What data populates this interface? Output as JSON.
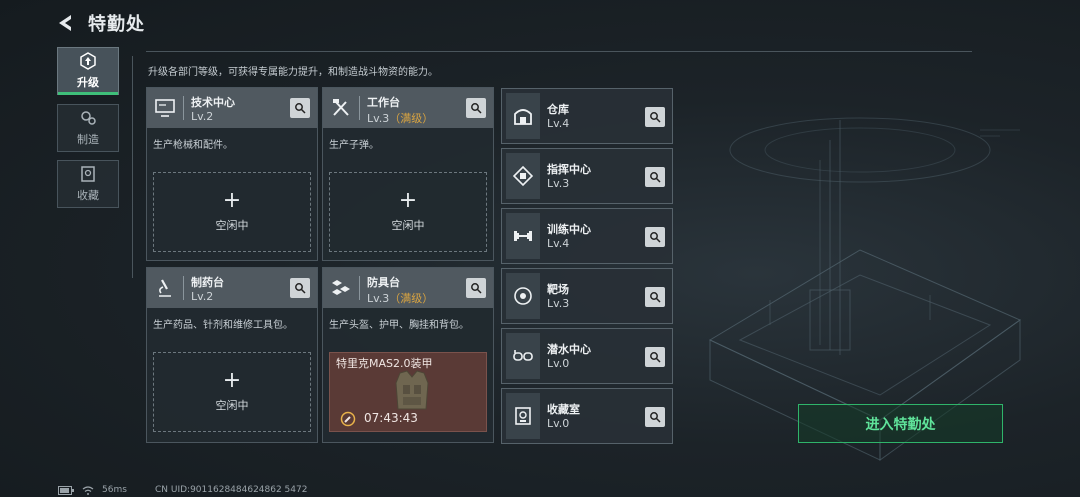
{
  "header": {
    "title": "特勤处"
  },
  "sidebar": {
    "tabs": [
      {
        "label": "升级",
        "icon": "upgrade-icon",
        "active": true
      },
      {
        "label": "制造",
        "icon": "gears-icon",
        "active": false
      },
      {
        "label": "收藏",
        "icon": "collection-icon",
        "active": false
      }
    ]
  },
  "main": {
    "description": "升级各部门等级，可获得专属能力提升，和制造战斗物资的能力。",
    "large_cards": [
      {
        "name": "技术中心",
        "level": "Lv.2",
        "max": "",
        "desc": "生产枪械和配件。",
        "slot": "空闲中",
        "icon": "monitor-icon"
      },
      {
        "name": "工作台",
        "level": "Lv.3",
        "max": "（满级）",
        "desc": "生产子弹。",
        "slot": "空闲中",
        "icon": "tools-icon"
      },
      {
        "name": "制药台",
        "level": "Lv.2",
        "max": "",
        "desc": "生产药品、针剂和维修工具包。",
        "slot": "空闲中",
        "icon": "microscope-icon"
      },
      {
        "name": "防具台",
        "level": "Lv.3",
        "max": "（满级）",
        "desc": "生产头盔、护甲、胸挂和背包。",
        "icon": "armor-box-icon",
        "crafting": {
          "item": "特里克MAS2.0装甲",
          "time": "07:43:43"
        }
      }
    ],
    "row_cards": [
      {
        "name": "仓库",
        "level": "Lv.4",
        "icon": "warehouse-icon"
      },
      {
        "name": "指挥中心",
        "level": "Lv.3",
        "icon": "command-icon"
      },
      {
        "name": "训练中心",
        "level": "Lv.4",
        "icon": "dumbbell-icon"
      },
      {
        "name": "靶场",
        "level": "Lv.3",
        "icon": "target-icon"
      },
      {
        "name": "潜水中心",
        "level": "Lv.0",
        "icon": "goggles-icon"
      },
      {
        "name": "收藏室",
        "level": "Lv.0",
        "icon": "display-case-icon"
      }
    ]
  },
  "enter_button": "进入特勤处",
  "status": {
    "ping": "56ms",
    "uid": "CN UID:9011628484624862 5472"
  },
  "colors": {
    "accent_green": "#2fb46a",
    "max_level": "#d9a441",
    "crafting_bg": "#5a3a36"
  }
}
